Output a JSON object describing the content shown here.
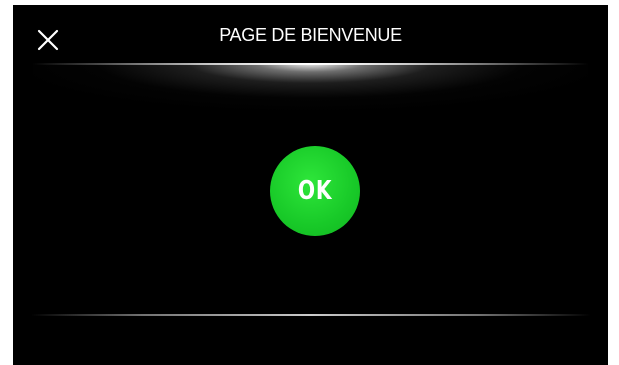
{
  "header": {
    "title": "PAGE DE BIENVENUE",
    "close_icon": "close-icon"
  },
  "main": {
    "confirm_label": "OK",
    "confirm_color": "#18c928"
  },
  "colors": {
    "background": "#000000",
    "text": "#ffffff"
  }
}
